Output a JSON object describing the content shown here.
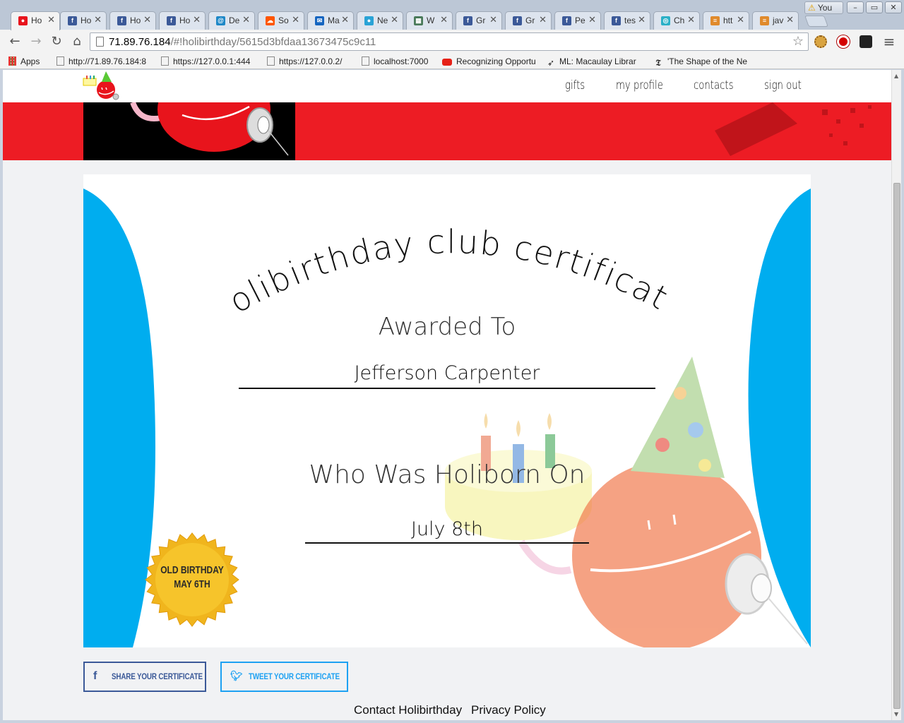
{
  "browser": {
    "tabs": [
      {
        "title": "Ho",
        "favicon": "holibirthday-icon",
        "active": true
      },
      {
        "title": "Ho",
        "favicon": "facebook-icon"
      },
      {
        "title": "Ho",
        "favicon": "facebook-icon"
      },
      {
        "title": "Ho",
        "favicon": "facebook-icon"
      },
      {
        "title": "De",
        "favicon": "swirl-icon"
      },
      {
        "title": "So",
        "favicon": "soundcloud-icon"
      },
      {
        "title": "Ma",
        "favicon": "mail-icon"
      },
      {
        "title": "Ne",
        "favicon": "droplet-icon"
      },
      {
        "title": "W",
        "favicon": "image-icon"
      },
      {
        "title": "Gr",
        "favicon": "facebook-icon"
      },
      {
        "title": "Gr",
        "favicon": "facebook-icon"
      },
      {
        "title": "Pe",
        "favicon": "facebook-icon"
      },
      {
        "title": "tes",
        "favicon": "facebook-icon"
      },
      {
        "title": "Ch",
        "favicon": "chrome-web-icon"
      },
      {
        "title": "htt",
        "favicon": "stackoverflow-icon"
      },
      {
        "title": "jav",
        "favicon": "stackoverflow-icon"
      }
    ],
    "profile_name": "You",
    "url_host": "71.89.76.184",
    "url_path": "/#!holibirthday/5615d3bfdaa13673475c9c11",
    "bookmarks": [
      {
        "label": "Apps",
        "icon": "apps-grid-icon"
      },
      {
        "label": "http://71.89.76.184:8",
        "icon": "page-icon"
      },
      {
        "label": "https://127.0.0.1:444",
        "icon": "page-icon"
      },
      {
        "label": "https://127.0.0.2/",
        "icon": "page-icon"
      },
      {
        "label": "localhost:7000",
        "icon": "page-icon"
      },
      {
        "label": "Recognizing Opportu",
        "icon": "youtube-icon"
      },
      {
        "label": "ML: Macaulay Librar",
        "icon": "bird-icon"
      },
      {
        "label": "'The Shape of the Ne",
        "icon": "nyt-icon"
      }
    ]
  },
  "site": {
    "nav": [
      "gifts",
      "my profile",
      "contacts",
      "sign out"
    ],
    "certificate": {
      "title": "holibirthday club certificate",
      "awarded_label": "Awarded To",
      "recipient": "Jefferson Carpenter",
      "holiborn_label": "Who Was Holiborn On",
      "date": "July 8th",
      "badge_line1": "OLD BIRTHDAY",
      "badge_line2": "MAY 6TH"
    },
    "share": {
      "facebook_label": "SHARE YOUR CERTIFICATE",
      "twitter_label": "TWEET YOUR CERTIFICATE"
    },
    "footer": {
      "contact": "Contact Holibirthday",
      "privacy": "Privacy Policy"
    },
    "colors": {
      "hero_red": "#ed1c24",
      "curtain_blue": "#00adef",
      "facebook_blue": "#3b5998",
      "twitter_blue": "#1da1f2",
      "badge_gold": "#f0b51d"
    }
  }
}
